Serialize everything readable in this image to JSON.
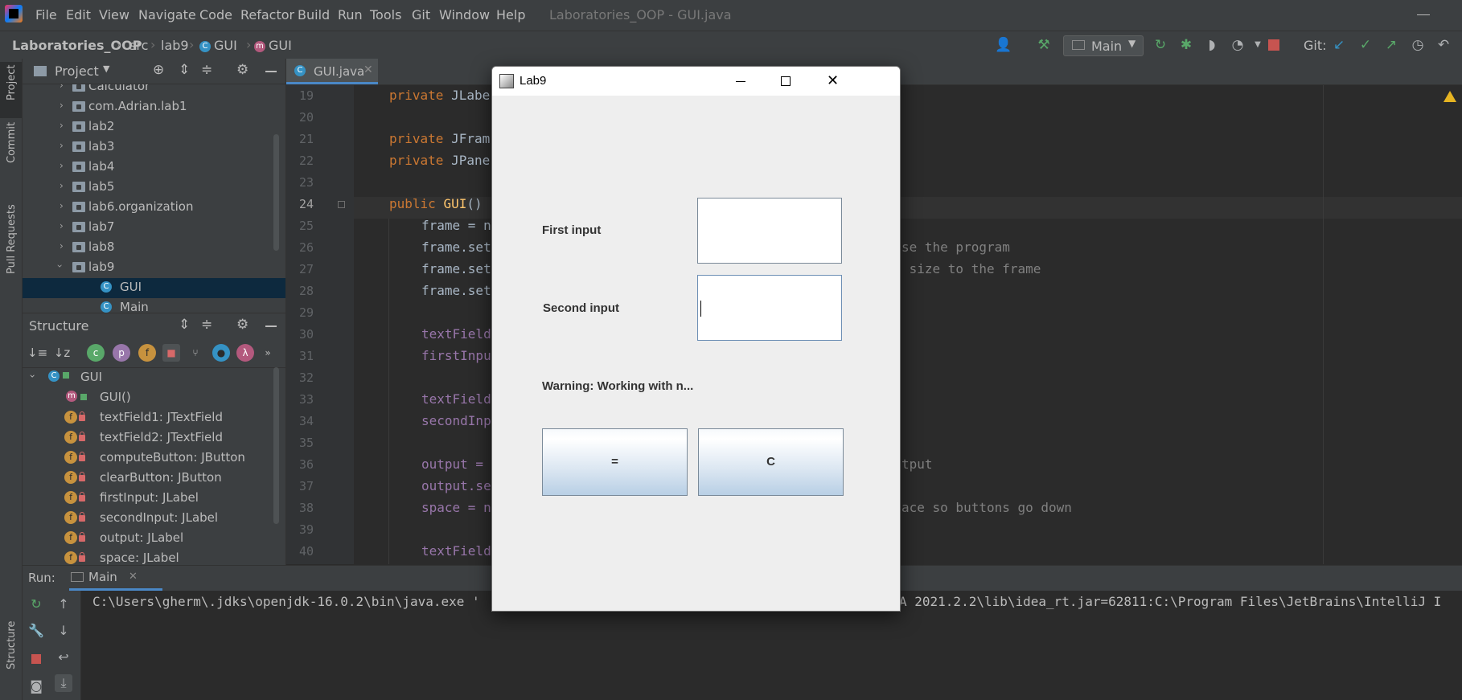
{
  "menubar": {
    "items": [
      "File",
      "Edit",
      "View",
      "Navigate",
      "Code",
      "Refactor",
      "Build",
      "Run",
      "Tools",
      "Git",
      "Window",
      "Help"
    ],
    "window_title": "Laboratories_OOP - GUI.java"
  },
  "navbar": {
    "breadcrumbs": [
      "Laboratories_OOP",
      "src",
      "lab9",
      "GUI",
      "GUI"
    ],
    "run_config": "Main",
    "git_label": "Git:"
  },
  "left_strip": {
    "tabs": [
      "Project",
      "Commit",
      "Pull Requests",
      "Structure"
    ]
  },
  "project": {
    "title": "Project",
    "tree": [
      {
        "label": "Calculator",
        "kind": "folder"
      },
      {
        "label": "com.Adrian.lab1",
        "kind": "folder"
      },
      {
        "label": "lab2",
        "kind": "folder"
      },
      {
        "label": "lab3",
        "kind": "folder"
      },
      {
        "label": "lab4",
        "kind": "folder"
      },
      {
        "label": "lab5",
        "kind": "folder"
      },
      {
        "label": "lab6.organization",
        "kind": "folder"
      },
      {
        "label": "lab7",
        "kind": "folder"
      },
      {
        "label": "lab8",
        "kind": "folder"
      },
      {
        "label": "lab9",
        "kind": "folder-open"
      },
      {
        "label": "GUI",
        "kind": "class"
      },
      {
        "label": "Main",
        "kind": "class"
      }
    ]
  },
  "structure": {
    "title": "Structure",
    "root": "GUI",
    "members": [
      {
        "label": "GUI()",
        "kind": "method"
      },
      {
        "label": "textField1: JTextField",
        "kind": "field"
      },
      {
        "label": "textField2: JTextField",
        "kind": "field"
      },
      {
        "label": "computeButton: JButton",
        "kind": "field"
      },
      {
        "label": "clearButton: JButton",
        "kind": "field"
      },
      {
        "label": "firstInput: JLabel",
        "kind": "field"
      },
      {
        "label": "secondInput: JLabel",
        "kind": "field"
      },
      {
        "label": "output: JLabel",
        "kind": "field"
      },
      {
        "label": "space: JLabel",
        "kind": "field"
      }
    ]
  },
  "editor": {
    "tab_label": "GUI.java",
    "line_numbers": [
      "19",
      "20",
      "21",
      "22",
      "23",
      "24",
      "25",
      "26",
      "27",
      "28",
      "29",
      "30",
      "31",
      "32",
      "33",
      "34",
      "35",
      "36",
      "37",
      "38",
      "39",
      "40"
    ],
    "lines": {
      "l19": "JLabe",
      "l21": "JFram",
      "l22": "JPane",
      "l24_fn": "GUI",
      "l24_rest": "()",
      "l25": "frame = n",
      "l26": "frame.set",
      "l26_tail": "se the program",
      "l27": "frame.set",
      "l27_tail": " size to the frame",
      "l28": "frame.set",
      "l30": "textField",
      "l31": "firstInpu",
      "l33": "textField",
      "l34": "secondInp",
      "l36": "output = ",
      "l36_tail": "tput",
      "l37": "output.se",
      "l38": "space = n",
      "l38_tail": "ace so buttons go down",
      "l40": "textField"
    },
    "kw_private": "private",
    "kw_public": "public"
  },
  "run": {
    "label": "Run:",
    "tab": "Main",
    "console_left": "C:\\Users\\gherm\\.jdks\\openjdk-16.0.2\\bin\\java.exe '",
    "console_right": "A 2021.2.2\\lib\\idea_rt.jar=62811:C:\\Program Files\\JetBrains\\IntelliJ I"
  },
  "dialog": {
    "title": "Lab9",
    "first_label": "First input",
    "second_label": "Second input",
    "first_value": "",
    "second_value": "",
    "warning": "Warning: Working with n...",
    "compute_button": "=",
    "clear_button": "C"
  },
  "colors": {
    "ide_background": "#2b2b2b",
    "panel": "#3c3f41",
    "keyword": "#cc7832",
    "function": "#ffc66d",
    "selection": "#0d293e",
    "accent": "#4a88c7",
    "dialog_background": "#eeeeee"
  }
}
